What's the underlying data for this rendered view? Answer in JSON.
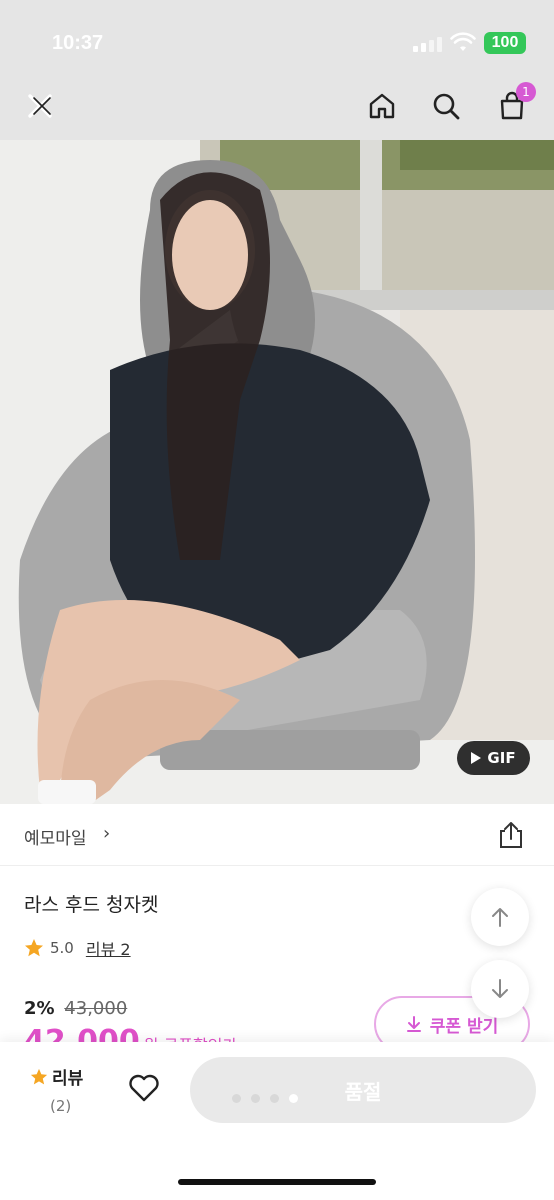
{
  "status": {
    "time": "10:37",
    "battery": "100"
  },
  "header": {
    "cart_count": "1"
  },
  "photo": {
    "gif_label": "GIF"
  },
  "store": {
    "name": "예모마일"
  },
  "product": {
    "title": "라스 후드 청자켓",
    "rating": "5.0",
    "review_link": "리뷰 2",
    "discount": "2%",
    "original_price": "43,000",
    "sale_price": "42,000",
    "price_suffix": "원 쿠폰할인가"
  },
  "coupon": {
    "label": "쿠폰 받기"
  },
  "bottom": {
    "review_label": "리뷰",
    "review_count": "(2)",
    "buy_label": "품절"
  },
  "colors": {
    "accent": "#d659d3",
    "price": "#e050c8",
    "star": "#f5a623"
  }
}
